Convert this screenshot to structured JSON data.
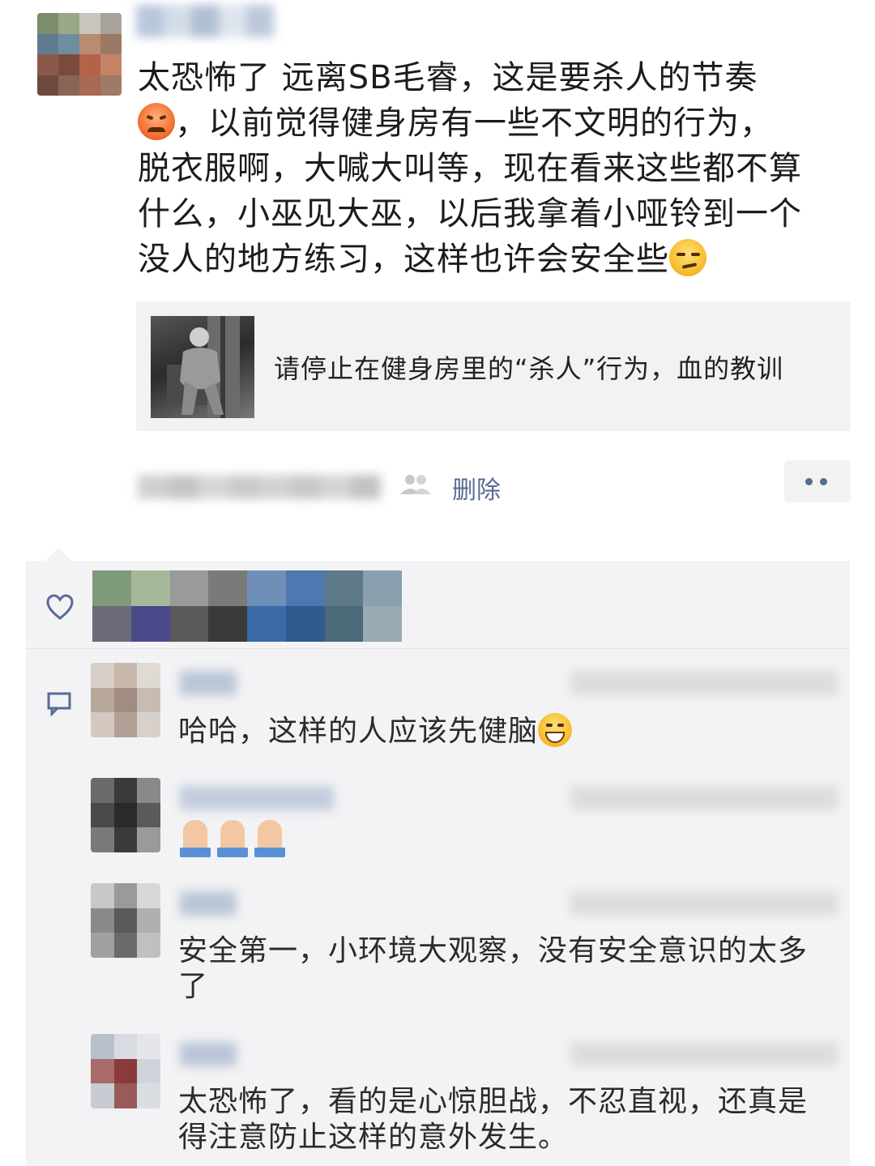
{
  "post": {
    "text_line1": "太恐怖了 远离SB毛睿，这是要杀人的节奏",
    "text_line2": "，以前觉得健身房有一些不文明的行为，",
    "text_line3": "脱衣服啊，大喊大叫等，现在看来这些都不算",
    "text_line4": "什么，小巫见大巫，以后我拿着小哑铃到一个",
    "text_line5": "没人的地方练习，这样也许会安全些",
    "emoji_1": "angry-face-icon",
    "emoji_2": "smirk-face-icon"
  },
  "link_card": {
    "title": "请停止在健身房里的“杀人”行为，血的教训"
  },
  "actions": {
    "delete_label": "删除",
    "accent_color": "#576b95"
  },
  "comments": [
    {
      "text": "哈哈，这样的人应该先健脑",
      "emoji": "grin-face-icon"
    },
    {
      "text": "",
      "emoji": "folded-hands-icon"
    },
    {
      "text_line1": "安全第一，小环境大观察，没有安全意识的太多",
      "text_line2": "了"
    },
    {
      "text_line1": "太恐怖了，看的是心惊胆战，不忍直视，还真是",
      "text_line2": "得注意防止这样的意外发生。"
    }
  ]
}
